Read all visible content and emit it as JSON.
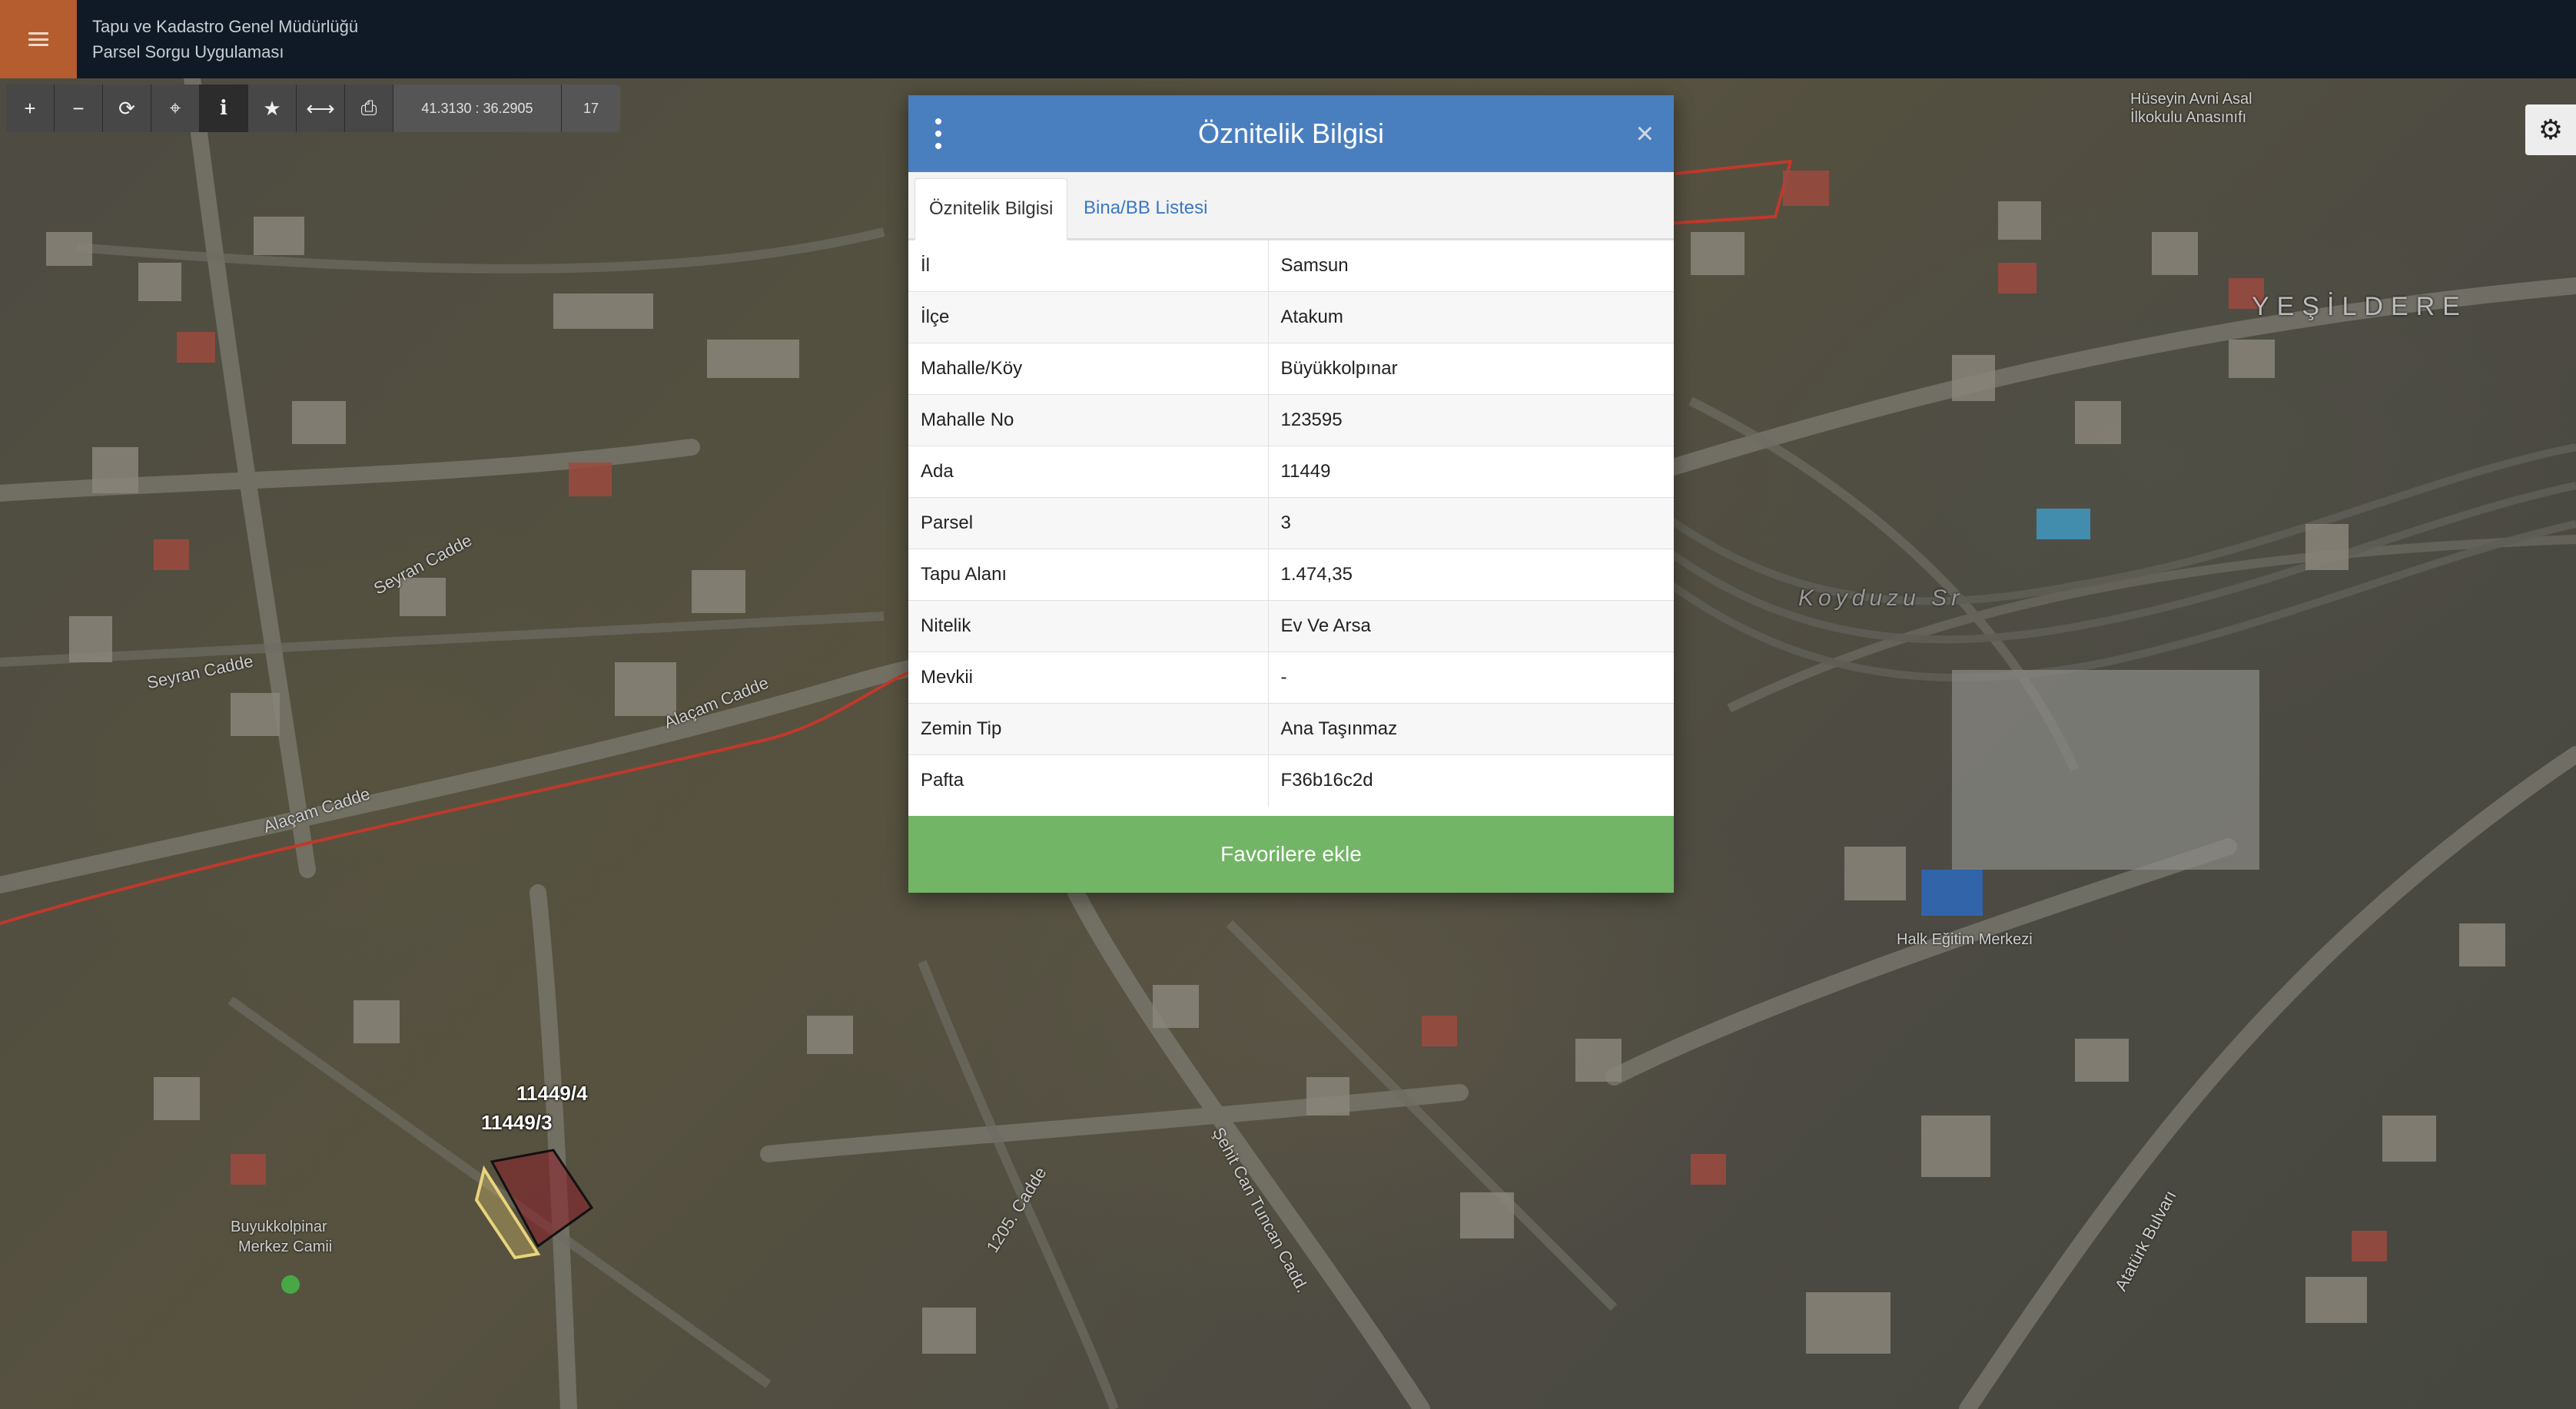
{
  "header": {
    "org_name": "Tapu ve Kadastro Genel Müdürlüğü",
    "app_name": "Parsel Sorgu Uygulaması"
  },
  "toolbar": {
    "buttons": [
      {
        "name": "zoom-in-button",
        "glyph": "+"
      },
      {
        "name": "zoom-out-button",
        "glyph": "−"
      },
      {
        "name": "refresh-button",
        "glyph": "⟳"
      },
      {
        "name": "locate-button",
        "glyph": "⌖"
      },
      {
        "name": "info-button",
        "glyph": "i"
      },
      {
        "name": "favorites-button",
        "glyph": "★"
      },
      {
        "name": "measure-button",
        "glyph": "⟷"
      },
      {
        "name": "print-button",
        "glyph": "⎙"
      }
    ],
    "coordinates": "41.3130 : 36.2905",
    "zoom_level": "17"
  },
  "dialog": {
    "title": "Öznitelik Bilgisi",
    "close_glyph": "×",
    "tabs": [
      "Öznitelik Bilgisi",
      "Bina/BB Listesi"
    ],
    "rows": [
      {
        "key": "İl",
        "value": "Samsun"
      },
      {
        "key": "İlçe",
        "value": "Atakum"
      },
      {
        "key": "Mahalle/Köy",
        "value": "Büyükkolpınar"
      },
      {
        "key": "Mahalle No",
        "value": "123595"
      },
      {
        "key": "Ada",
        "value": "11449"
      },
      {
        "key": "Parsel",
        "value": "3"
      },
      {
        "key": "Tapu Alanı",
        "value": "1.474,35"
      },
      {
        "key": "Nitelik",
        "value": "Ev Ve Arsa"
      },
      {
        "key": "Mevkii",
        "value": "-"
      },
      {
        "key": "Zemin Tip",
        "value": "Ana Taşınmaz"
      },
      {
        "key": "Pafta",
        "value": "F36b16c2d"
      }
    ],
    "favorite_button": "Favorilere ekle"
  },
  "map": {
    "parcel_labels": [
      "11449/4",
      "11449/3"
    ],
    "place_labels": [
      "Hüseyin Avni Asal",
      "İlkokulu Anasınıfı",
      "YEŞİLDERE",
      "Koyduzu Sr",
      "Halk Eğitim Merkezi",
      "Buyukkolpinar",
      "Merkez Camii"
    ],
    "street_labels": [
      "Seyran Cadde",
      "Seyran Cadde",
      "Alaçam Cadde",
      "Alaçam Cadde",
      "Şehit Can Tuncan Cadd.",
      "Atatürk Bulvarı",
      "1205. Cadde"
    ]
  },
  "settings_icon": "gear-icon"
}
